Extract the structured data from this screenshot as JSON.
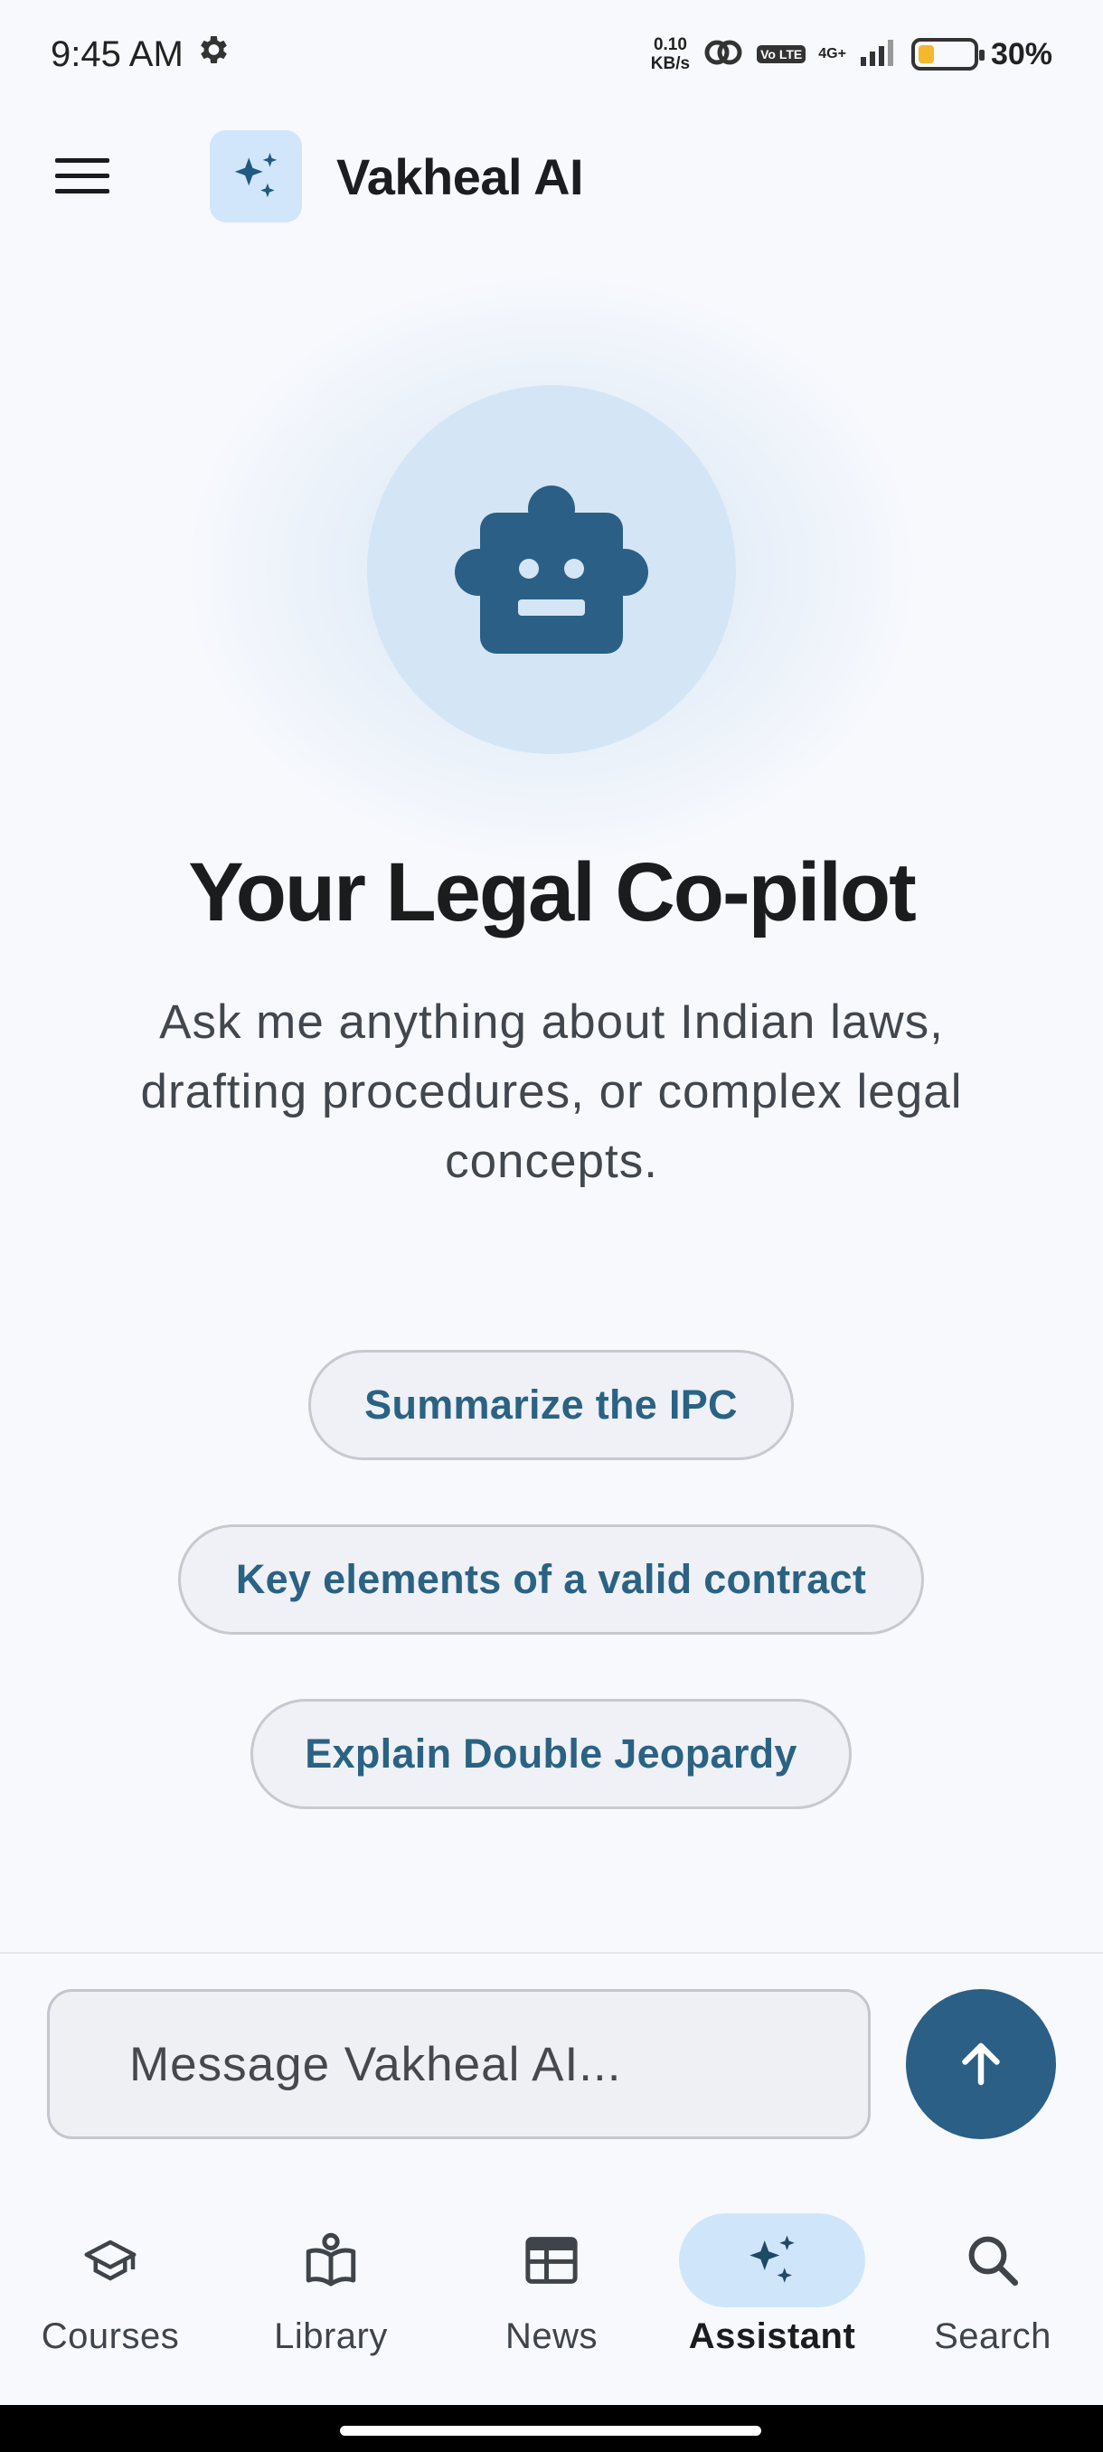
{
  "status_bar": {
    "time": "9:45 AM",
    "net_speed_value": "0.10",
    "net_speed_unit": "KB/s",
    "volte": "Vo LTE",
    "network": "4G+",
    "battery_percent": "30%",
    "battery_level": 0.3,
    "battery_color": "#f5b72c"
  },
  "app_bar": {
    "title": "Vakheal AI",
    "menu_icon": "hamburger-icon",
    "logo_icon": "sparkles-icon"
  },
  "hero": {
    "icon": "robot-icon",
    "title": "Your Legal Co-pilot",
    "subtitle": "Ask me anything about Indian laws, drafting procedures, or complex legal concepts."
  },
  "suggestions": [
    {
      "label": "Summarize the IPC"
    },
    {
      "label": "Key elements of a valid contract"
    },
    {
      "label": "Explain Double Jeopardy"
    }
  ],
  "composer": {
    "placeholder": "Message Vakheal AI...",
    "value": "",
    "send_icon": "arrow-up-icon"
  },
  "bottom_nav": {
    "items": [
      {
        "label": "Courses",
        "icon": "graduation-cap-icon",
        "active": false
      },
      {
        "label": "Library",
        "icon": "book-icon",
        "active": false
      },
      {
        "label": "News",
        "icon": "newspaper-icon",
        "active": false
      },
      {
        "label": "Assistant",
        "icon": "sparkles-icon",
        "active": true
      },
      {
        "label": "Search",
        "icon": "search-icon",
        "active": false
      }
    ]
  },
  "colors": {
    "accent": "#2b5f86",
    "accent_light": "#d1e6fa",
    "chip_text": "#2a6283",
    "background": "#f7f9fd"
  }
}
